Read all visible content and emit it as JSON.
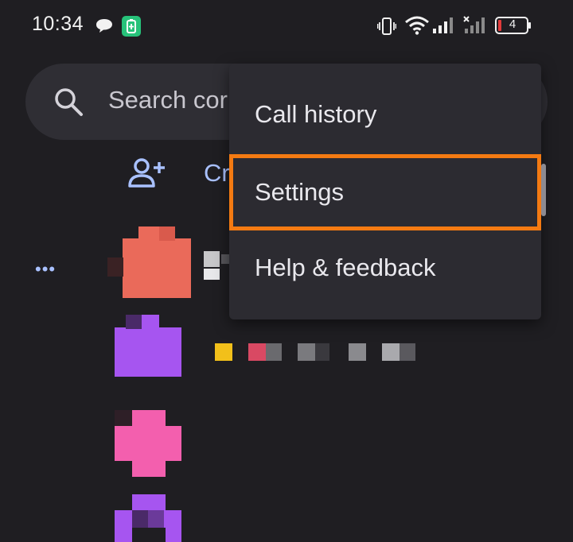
{
  "status_bar": {
    "time": "10:34",
    "battery_level": "4",
    "icons": [
      "chat-bubble-icon",
      "battery-saver-icon",
      "vibrate-icon",
      "wifi-icon",
      "signal-icon",
      "signal-no-service-icon",
      "battery-icon"
    ]
  },
  "search": {
    "placeholder": "Search cor"
  },
  "actions": {
    "create_label": "Cr",
    "more_label": "•••"
  },
  "menu": {
    "items": [
      {
        "label": "Call history"
      },
      {
        "label": "Settings",
        "highlighted": true
      },
      {
        "label": "Help & feedback"
      }
    ]
  },
  "colors": {
    "background": "#1f1e22",
    "menu_background": "#2c2b31",
    "highlight": "#f47a12",
    "accent": "#a9c1ff",
    "avatar_red": "#ea6a5a",
    "avatar_purple": "#a655f0",
    "avatar_pink": "#f35fae"
  }
}
